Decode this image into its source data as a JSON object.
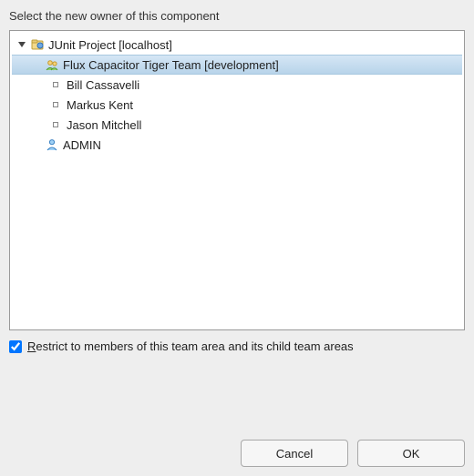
{
  "title": "Select the new owner of this component",
  "tree": {
    "root": {
      "label": "JUnit Project [localhost]",
      "children": {
        "team": {
          "label": "Flux Capacitor Tiger Team [development]",
          "selected": true,
          "members": [
            {
              "label": "Bill Cassavelli"
            },
            {
              "label": "Markus Kent"
            },
            {
              "label": "Jason Mitchell"
            }
          ]
        },
        "admin": {
          "label": "ADMIN"
        }
      }
    }
  },
  "checkbox": {
    "label_pre": "R",
    "label_rest": "estrict to members of this team area and its child team areas",
    "checked": true
  },
  "buttons": {
    "cancel": "Cancel",
    "ok": "OK"
  }
}
